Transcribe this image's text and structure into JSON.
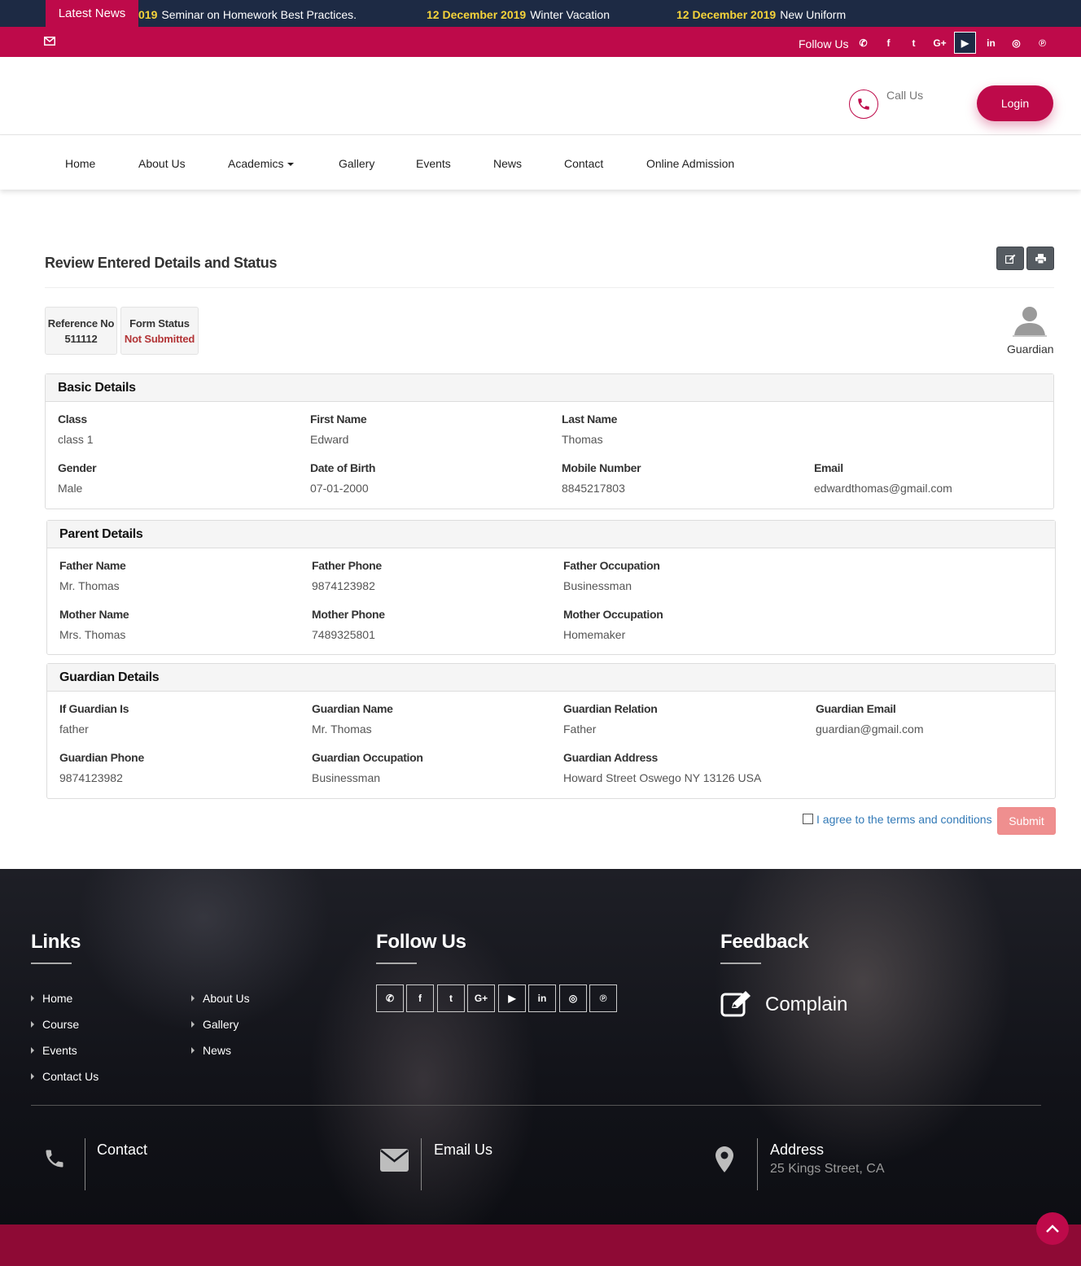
{
  "ticker": {
    "label": "Latest News",
    "items": [
      {
        "date": "019",
        "title": "Seminar on Homework Best Practices."
      },
      {
        "date": "12 December 2019",
        "title": "Winter Vacation"
      },
      {
        "date": "12 December 2019",
        "title": "New Uniform"
      }
    ]
  },
  "social_bar": {
    "follow_label": "Follow Us",
    "icons": [
      "whatsapp-icon",
      "facebook-icon",
      "twitter-icon",
      "google-plus-icon",
      "youtube-icon",
      "linkedin-icon",
      "instagram-icon",
      "pinterest-icon"
    ],
    "glyphs": [
      "✆",
      "f",
      "t",
      "G+",
      "▶",
      "in",
      "◎",
      "℗"
    ]
  },
  "header": {
    "call_label": "Call Us",
    "login_label": "Login"
  },
  "nav": {
    "items": [
      "Home",
      "About Us",
      "Academics",
      "Gallery",
      "Events",
      "News",
      "Contact",
      "Online Admission"
    ]
  },
  "main": {
    "title": "Review Entered Details and Status",
    "reference": {
      "label": "Reference No",
      "value": "511112"
    },
    "form_status": {
      "label": "Form Status",
      "value": "Not Submitted"
    },
    "avatar_label": "Guardian",
    "basic": {
      "heading": "Basic Details",
      "class_label": "Class",
      "class_value": "class 1",
      "first_label": "First Name",
      "first_value": "Edward",
      "last_label": "Last Name",
      "last_value": "Thomas",
      "gender_label": "Gender",
      "gender_value": "Male",
      "dob_label": "Date of Birth",
      "dob_value": "07-01-2000",
      "mobile_label": "Mobile Number",
      "mobile_value": "8845217803",
      "email_label": "Email",
      "email_value": "edwardthomas@gmail.com"
    },
    "parent": {
      "heading": "Parent Details",
      "father_name_label": "Father Name",
      "father_name_value": "Mr. Thomas",
      "father_phone_label": "Father Phone",
      "father_phone_value": "9874123982",
      "father_occ_label": "Father Occupation",
      "father_occ_value": "Businessman",
      "mother_name_label": "Mother Name",
      "mother_name_value": "Mrs. Thomas",
      "mother_phone_label": "Mother Phone",
      "mother_phone_value": "7489325801",
      "mother_occ_label": "Mother Occupation",
      "mother_occ_value": "Homemaker"
    },
    "guardian": {
      "heading": "Guardian Details",
      "is_label": "If Guardian Is",
      "is_value": "father",
      "name_label": "Guardian Name",
      "name_value": "Mr. Thomas",
      "relation_label": "Guardian Relation",
      "relation_value": "Father",
      "email_label": "Guardian Email",
      "email_value": "guardian@gmail.com",
      "phone_label": "Guardian Phone",
      "phone_value": "9874123982",
      "occ_label": "Guardian Occupation",
      "occ_value": "Businessman",
      "address_label": "Guardian Address",
      "address_value": "Howard Street Oswego NY 13126 USA"
    },
    "terms_label": "I agree to the terms and conditions",
    "submit_label": "Submit"
  },
  "footer": {
    "links_heading": "Links",
    "follow_heading": "Follow Us",
    "feedback_heading": "Feedback",
    "links_col1": [
      "Home",
      "Course",
      "Events",
      "Contact Us"
    ],
    "links_col2": [
      "About Us",
      "Gallery",
      "News"
    ],
    "complain_label": "Complain",
    "contact_title": "Contact",
    "email_title": "Email Us",
    "address_title": "Address",
    "address_value": "25 Kings Street, CA"
  },
  "colors": {
    "brand": "#be0a4a",
    "navy": "#1d2a44",
    "ticker_date": "#f5d33a",
    "status_red": "#b23436"
  }
}
